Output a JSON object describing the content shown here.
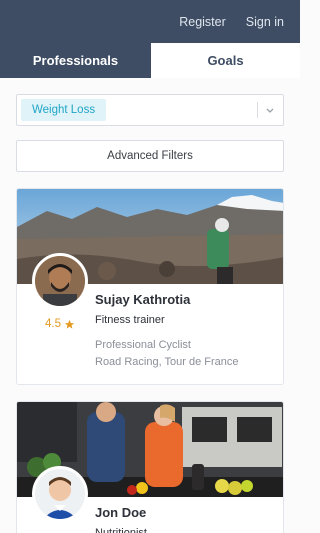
{
  "topbar": {
    "register": "Register",
    "signin": "Sign in"
  },
  "tabs": [
    {
      "label": "Professionals"
    },
    {
      "label": "Goals"
    }
  ],
  "filter": {
    "selected_tag": "Weight Loss",
    "advanced_label": "Advanced Filters"
  },
  "professionals": [
    {
      "name": "Sujay Kathrotia",
      "role": "Fitness trainer",
      "rating": "4.5",
      "desc_line1": "Professional Cyclist",
      "desc_line2": "Road Racing, Tour de France"
    },
    {
      "name": "Jon Doe",
      "role": "Nutritionist"
    }
  ],
  "colors": {
    "header": "#3e4d63",
    "tag_bg": "#dff3f8",
    "tag_text": "#22a5c7",
    "star": "#e59a21"
  }
}
